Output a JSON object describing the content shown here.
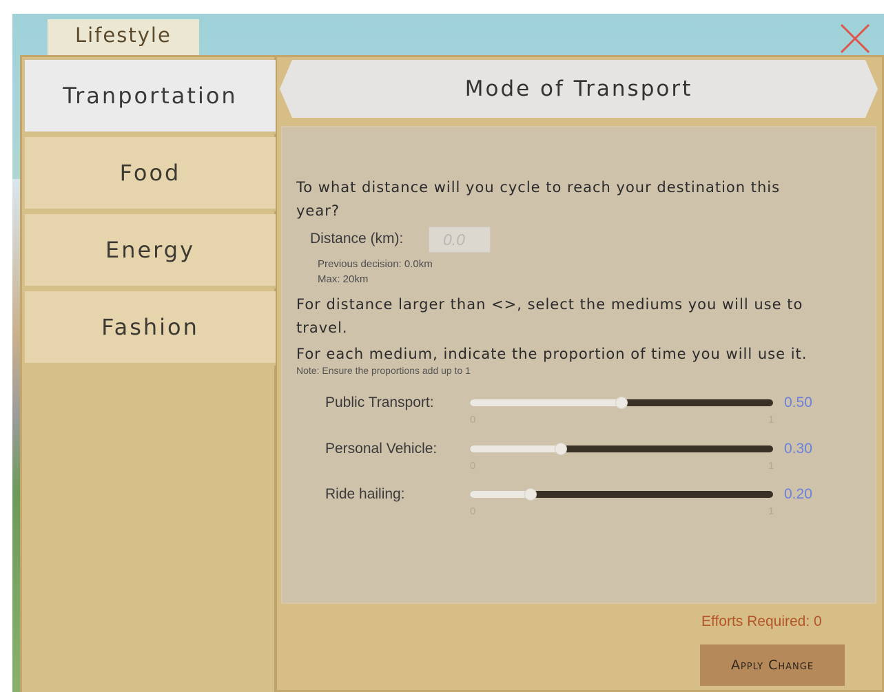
{
  "tab": {
    "label": "Lifestyle"
  },
  "sidebar": {
    "items": [
      {
        "label": "Tranportation",
        "active": true
      },
      {
        "label": "Food",
        "active": false
      },
      {
        "label": "Energy",
        "active": false
      },
      {
        "label": "Fashion",
        "active": false
      }
    ]
  },
  "header": {
    "title": "Mode of Transport"
  },
  "question1": {
    "line1": "To what distance will you cycle to reach your destination this",
    "line2": "year?"
  },
  "distance": {
    "label": "Distance (km):",
    "placeholder": "0.0",
    "previous": "Previous decision: 0.0km",
    "max": "Max: 20km"
  },
  "question2": {
    "line1": "For distance larger than <>, select the mediums you will use to",
    "line2": "travel."
  },
  "question3": {
    "line1": "For each medium, indicate the proportion of time you will use it.",
    "note": "Note: Ensure the proportions add up to 1"
  },
  "sliders": [
    {
      "label": "Public Transport:",
      "value": 0.5,
      "display": "0.50",
      "min_label": "0",
      "max_label": "1"
    },
    {
      "label": "Personal Vehicle:",
      "value": 0.3,
      "display": "0.30",
      "min_label": "0",
      "max_label": "1"
    },
    {
      "label": "Ride hailing:",
      "value": 0.2,
      "display": "0.20",
      "min_label": "0",
      "max_label": "1"
    }
  ],
  "footer": {
    "efforts": "Efforts Required: 0",
    "apply_label": "Apply Change"
  },
  "colors": {
    "value_text": "#6a7fe0",
    "efforts_text": "#b5562a",
    "close_icon": "#e0554a"
  }
}
